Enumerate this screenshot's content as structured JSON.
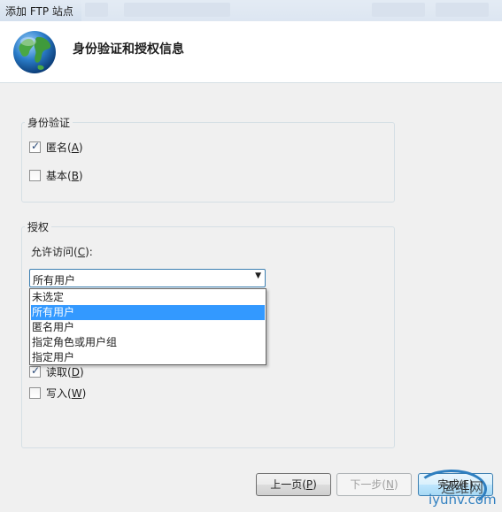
{
  "window": {
    "title": "添加 FTP 站点"
  },
  "header": {
    "title": "身份验证和授权信息",
    "icon": "globe-icon"
  },
  "auth_group": {
    "title": "身份验证",
    "anonymous": {
      "label_prefix": "匿名(",
      "accel": "A",
      "label_suffix": ")",
      "checked": true
    },
    "basic": {
      "label_prefix": "基本(",
      "accel": "B",
      "label_suffix": ")",
      "checked": false
    }
  },
  "authz_group": {
    "title": "授权",
    "allow_access": {
      "label_prefix": "允许访问(",
      "accel": "C",
      "label_suffix": "):"
    },
    "combo": {
      "value": "所有用户"
    },
    "options": [
      "未选定",
      "所有用户",
      "匿名用户",
      "指定角色或用户组",
      "指定用户"
    ],
    "selected_index": 1,
    "permissions": {
      "read": {
        "label_prefix": "读取(",
        "accel": "D",
        "label_suffix": ")",
        "checked": true
      },
      "write": {
        "label_prefix": "写入(",
        "accel": "W",
        "label_suffix": ")",
        "checked": false
      }
    }
  },
  "buttons": {
    "prev": {
      "label_prefix": "上一页(",
      "accel": "P",
      "label_suffix": ")"
    },
    "next": {
      "label_prefix": "下一步(",
      "accel": "N",
      "label_suffix": ")",
      "disabled": true
    },
    "finish": {
      "label_prefix": "完成(",
      "accel": "F",
      "label_suffix": ")"
    }
  },
  "watermark": {
    "line1": "运维网",
    "line2": "iyunv.com"
  }
}
